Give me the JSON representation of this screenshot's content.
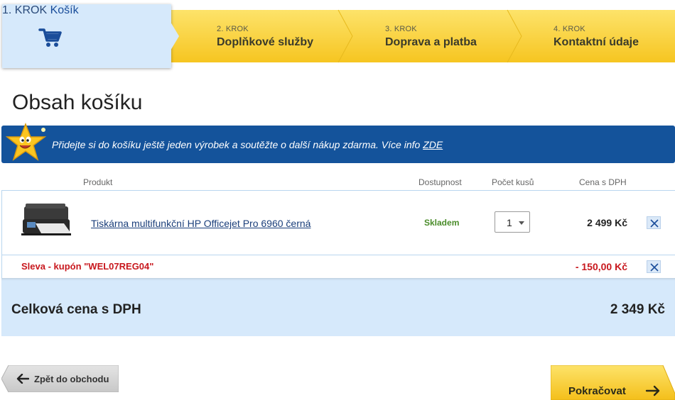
{
  "steps": [
    {
      "num": "1. KROK",
      "name": "Košík",
      "icon": "cart-icon",
      "active": true
    },
    {
      "num": "2. KROK",
      "name": "Doplňkové služby"
    },
    {
      "num": "3. KROK",
      "name": "Doprava a platba"
    },
    {
      "num": "4. KROK",
      "name": "Kontaktní údaje"
    }
  ],
  "page_title": "Obsah košíku",
  "banner": {
    "text": "Přidejte si do košíku ještě jeden výrobek a soutěžte o další nákup zdarma. Více info",
    "link": "ZDE",
    "icon": "star-mascot-icon"
  },
  "table": {
    "headers": {
      "product": "Produkt",
      "availability": "Dostupnost",
      "quantity": "Počet kusů",
      "price": "Cena s DPH"
    },
    "items": [
      {
        "name": "Tiskárna multifunkční HP Officejet Pro 6960 černá",
        "availability": "Skladem",
        "quantity": "1",
        "price": "2 499 Kč",
        "icon": "printer-icon"
      }
    ],
    "coupon": {
      "label": "Sleva - kupón \"WEL07REG04\"",
      "amount": "- 150,00 Kč"
    }
  },
  "total": {
    "label": "Celková cena s DPH",
    "value": "2 349 Kč"
  },
  "buttons": {
    "back": "Zpět do obchodu",
    "continue": "Pokračovat"
  },
  "colors": {
    "accent_yellow": "#fbd33a",
    "brand_blue": "#14539b",
    "light_blue": "#d6e9fb",
    "discount_red": "#c8181e",
    "stock_green": "#4a8c2a"
  }
}
